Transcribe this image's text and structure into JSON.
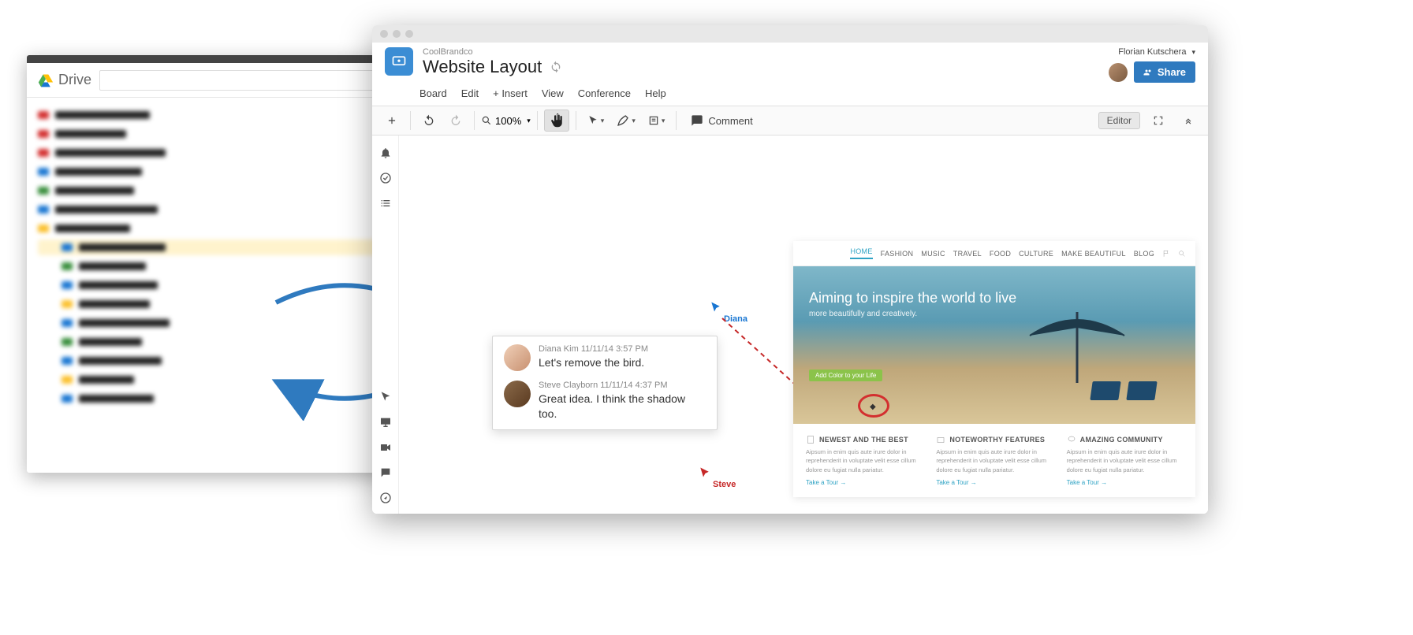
{
  "drive": {
    "title": "Drive"
  },
  "app": {
    "project": "CoolBrandco",
    "doc_title": "Website Layout",
    "user_name": "Florian Kutschera",
    "share_label": "Share",
    "menus": [
      "Board",
      "Edit",
      "+ Insert",
      "View",
      "Conference",
      "Help"
    ],
    "zoom": "100%",
    "comment_label": "Comment",
    "mode_badge": "Editor"
  },
  "comments": [
    {
      "author": "Diana Kim",
      "date": "11/11/14",
      "time": "3:57 PM",
      "text": "Let's remove the bird."
    },
    {
      "author": "Steve Clayborn",
      "date": "11/11/14",
      "time": "4:37 PM",
      "text": "Great idea. I think the shadow too."
    }
  ],
  "cursors": {
    "diana": "Diana",
    "steve": "Steve"
  },
  "mocksite": {
    "nav": [
      "HOME",
      "FASHION",
      "MUSIC",
      "TRAVEL",
      "FOOD",
      "CULTURE",
      "MAKE BEAUTIFUL",
      "BLOG"
    ],
    "hero_title": "Aiming to inspire the world to live",
    "hero_sub": "more beautifully and creatively.",
    "cta": "Add Color to your Life",
    "features": [
      {
        "h": "NEWEST AND THE BEST",
        "p": "Aipsum in enim quis aute irure dolor in reprehenderit in voluptate velit esse cillum dolore eu fugiat nulla pariatur.",
        "a": "Take a Tour →"
      },
      {
        "h": "NOTEWORTHY FEATURES",
        "p": "Aipsum in enim quis aute irure dolor in reprehenderit in voluptate velit esse cillum dolore eu fugiat nulla pariatur.",
        "a": "Take a Tour →"
      },
      {
        "h": "AMAZING COMMUNITY",
        "p": "Aipsum in enim quis aute irure dolor in reprehenderit in voluptate velit esse cillum dolore eu fugiat nulla pariatur.",
        "a": "Take a Tour →"
      }
    ]
  }
}
